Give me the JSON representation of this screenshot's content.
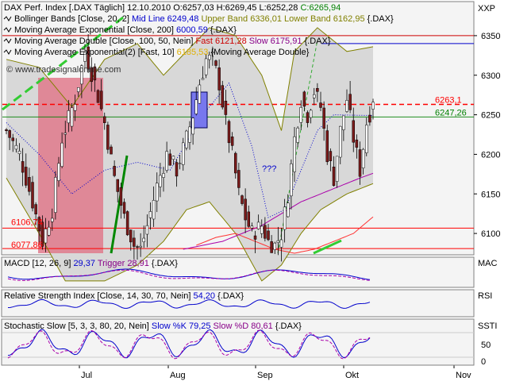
{
  "panels": {
    "main": {
      "title_parts": [
        {
          "text": "DAX Perf. Index [.DAX  Täglich] 12.10.2010 ",
          "color": "#000000"
        },
        {
          "text": "O:6257,03 ",
          "color": "#000000"
        },
        {
          "text": "H:6269,45 ",
          "color": "#000000"
        },
        {
          "text": "L:6252,28 ",
          "color": "#000000"
        },
        {
          "text": "C:6265,94",
          "color": "#008000"
        }
      ],
      "legend_lines": [
        [
          {
            "text": "Bollinger Bands [Close, 20, 2] ",
            "color": "#000000"
          },
          {
            "text": "Mid Line 6249,48 ",
            "color": "#0000cc"
          },
          {
            "text": "Upper Band 6336,01 ",
            "color": "#808000"
          },
          {
            "text": "Lower Band 6162,95 ",
            "color": "#808000"
          },
          {
            "text": "{.DAX}",
            "color": "#000000"
          }
        ],
        [
          {
            "text": "Moving Average Exponential [Close, 200] ",
            "color": "#000000"
          },
          {
            "text": "6000,59 ",
            "color": "#0000cc"
          },
          {
            "text": "{.DAX}",
            "color": "#000000"
          }
        ],
        [
          {
            "text": "Moving Average Double [Close, 100, 50, Nein] ",
            "color": "#000000"
          },
          {
            "text": "Fast 6121,28 ",
            "color": "#cc0000"
          },
          {
            "text": "Slow 6175,91 ",
            "color": "#880088"
          },
          {
            "text": "{.DAX}",
            "color": "#000000"
          }
        ],
        [
          {
            "text": "Moving Average Exponential(2) [Fast, 10] ",
            "color": "#000000"
          },
          {
            "text": "6185,53 ",
            "color": "#e0b000"
          },
          {
            "text": "{Moving Average Double}",
            "color": "#000000"
          }
        ]
      ],
      "watermark": "© www.tradesignalonline.com",
      "annotation": "???",
      "ylim": [
        6075,
        6375
      ],
      "ticks": [
        6100,
        6150,
        6200,
        6250,
        6300,
        6350
      ],
      "scale_label": "XXP",
      "price_labels": [
        {
          "text": "6263,1",
          "value": 6263.1,
          "color": "#ff0000"
        },
        {
          "text": "6247,26",
          "value": 6247.26,
          "color": "#008000"
        },
        {
          "text": "6106,74",
          "value": 6106.74,
          "color": "#ff0000"
        },
        {
          "text": "6077,86",
          "value": 6077.86,
          "color": "#ff0000"
        }
      ]
    },
    "macd": {
      "legend": [
        {
          "text": "MACD [12, 26, 9] ",
          "color": "#000000"
        },
        {
          "text": "29,37 ",
          "color": "#0000cc"
        },
        {
          "text": "Trigger 28,91 ",
          "color": "#880088"
        },
        {
          "text": "{.DAX}",
          "color": "#000000"
        }
      ],
      "scale_label": "MAC"
    },
    "rsi": {
      "legend": [
        {
          "text": "Relative Strength Index [Close, 14, 30, 70, Nein] ",
          "color": "#000000"
        },
        {
          "text": "54,20 ",
          "color": "#0000cc"
        },
        {
          "text": "{.DAX}",
          "color": "#000000"
        }
      ],
      "scale_label": "RSI"
    },
    "stoch": {
      "legend": [
        {
          "text": "Stochastic Slow [5, 3, 3, 80, 20, Nein] ",
          "color": "#000000"
        },
        {
          "text": "Slow %K 79,25 ",
          "color": "#0000cc"
        },
        {
          "text": "Slow %D 80,61 ",
          "color": "#880088"
        },
        {
          "text": "{.DAX}",
          "color": "#000000"
        }
      ],
      "ticks": [
        0,
        50
      ],
      "scale_label": "SSTI"
    }
  },
  "time_axis": [
    "Jul",
    "Aug",
    "Sep",
    "Okt",
    "Nov"
  ],
  "chart_data": {
    "type": "candlestick",
    "title": "DAX Perf. Index [.DAX  Täglich] 12.10.2010",
    "ylim": [
      6075,
      6375
    ],
    "last_bar": {
      "open": 6257.03,
      "high": 6269.45,
      "low": 6252.28,
      "close": 6265.94
    },
    "close_path": [
      [
        0,
        6230
      ],
      [
        4,
        6200
      ],
      [
        8,
        6140
      ],
      [
        11,
        6090
      ],
      [
        14,
        6130
      ],
      [
        17,
        6220
      ],
      [
        21,
        6270
      ],
      [
        24,
        6330
      ],
      [
        27,
        6290
      ],
      [
        30,
        6240
      ],
      [
        33,
        6170
      ],
      [
        36,
        6120
      ],
      [
        39,
        6085
      ],
      [
        41,
        6080
      ],
      [
        43,
        6110
      ],
      [
        46,
        6160
      ],
      [
        49,
        6200
      ],
      [
        52,
        6180
      ],
      [
        55,
        6220
      ],
      [
        57,
        6250
      ],
      [
        59,
        6290
      ],
      [
        61,
        6320
      ],
      [
        63,
        6320
      ],
      [
        65,
        6290
      ],
      [
        67,
        6240
      ],
      [
        69,
        6200
      ],
      [
        71,
        6150
      ],
      [
        73,
        6120
      ],
      [
        75,
        6100
      ],
      [
        78,
        6110
      ],
      [
        80,
        6090
      ],
      [
        82,
        6085
      ],
      [
        84,
        6100
      ],
      [
        86,
        6150
      ],
      [
        88,
        6220
      ],
      [
        90,
        6270
      ],
      [
        92,
        6250
      ],
      [
        94,
        6280
      ],
      [
        96,
        6260
      ],
      [
        98,
        6200
      ],
      [
        100,
        6170
      ],
      [
        102,
        6230
      ],
      [
        104,
        6270
      ],
      [
        106,
        6220
      ],
      [
        108,
        6180
      ],
      [
        110,
        6240
      ],
      [
        112,
        6265
      ]
    ],
    "series": [
      {
        "name": "Mid Line",
        "points": [
          [
            0,
            6240
          ],
          [
            10,
            6200
          ],
          [
            20,
            6150
          ],
          [
            30,
            6180
          ],
          [
            40,
            6190
          ],
          [
            50,
            6180
          ],
          [
            60,
            6250
          ],
          [
            68,
            6290
          ],
          [
            75,
            6210
          ],
          [
            80,
            6120
          ],
          [
            85,
            6130
          ],
          [
            90,
            6180
          ],
          [
            95,
            6230
          ],
          [
            100,
            6250
          ],
          [
            112,
            6249
          ]
        ]
      },
      {
        "name": "Upper Band",
        "points": [
          [
            0,
            6320
          ],
          [
            10,
            6310
          ],
          [
            20,
            6260
          ],
          [
            30,
            6320
          ],
          [
            40,
            6340
          ],
          [
            48,
            6300
          ],
          [
            55,
            6330
          ],
          [
            62,
            6360
          ],
          [
            70,
            6350
          ],
          [
            78,
            6300
          ],
          [
            84,
            6230
          ],
          [
            88,
            6330
          ],
          [
            95,
            6360
          ],
          [
            104,
            6330
          ],
          [
            112,
            6336
          ]
        ]
      },
      {
        "name": "Lower Band",
        "points": [
          [
            0,
            6170
          ],
          [
            10,
            6100
          ],
          [
            18,
            6040
          ],
          [
            30,
            6040
          ],
          [
            40,
            6060
          ],
          [
            48,
            6090
          ],
          [
            55,
            6130
          ],
          [
            62,
            6140
          ],
          [
            70,
            6100
          ],
          [
            78,
            6040
          ],
          [
            84,
            6060
          ],
          [
            90,
            6100
          ],
          [
            96,
            6130
          ],
          [
            104,
            6150
          ],
          [
            112,
            6163
          ]
        ]
      },
      {
        "name": "Fast",
        "points": [
          [
            58,
            6085
          ],
          [
            64,
            6095
          ],
          [
            70,
            6100
          ],
          [
            76,
            6090
          ],
          [
            82,
            6080
          ],
          [
            88,
            6075
          ],
          [
            94,
            6080
          ],
          [
            100,
            6090
          ],
          [
            106,
            6100
          ],
          [
            112,
            6121
          ]
        ]
      },
      {
        "name": "Slow",
        "points": [
          [
            54,
            6080
          ],
          [
            60,
            6085
          ],
          [
            66,
            6090
          ],
          [
            72,
            6100
          ],
          [
            78,
            6110
          ],
          [
            84,
            6125
          ],
          [
            90,
            6140
          ],
          [
            96,
            6150
          ],
          [
            102,
            6160
          ],
          [
            108,
            6170
          ],
          [
            112,
            6176
          ]
        ]
      }
    ],
    "lines": {
      "hline_6350": 6350,
      "hline_6340": 6340,
      "dashed_red": 6263.1,
      "green_level": 6247.26,
      "red_level_1": 6106.74,
      "red_level_2": 6077.86
    },
    "macd": {
      "value": 29.37,
      "trigger": 28.91
    },
    "rsi": {
      "value": 54.2
    },
    "stochastic": {
      "k": 79.25,
      "d": 80.61
    }
  }
}
